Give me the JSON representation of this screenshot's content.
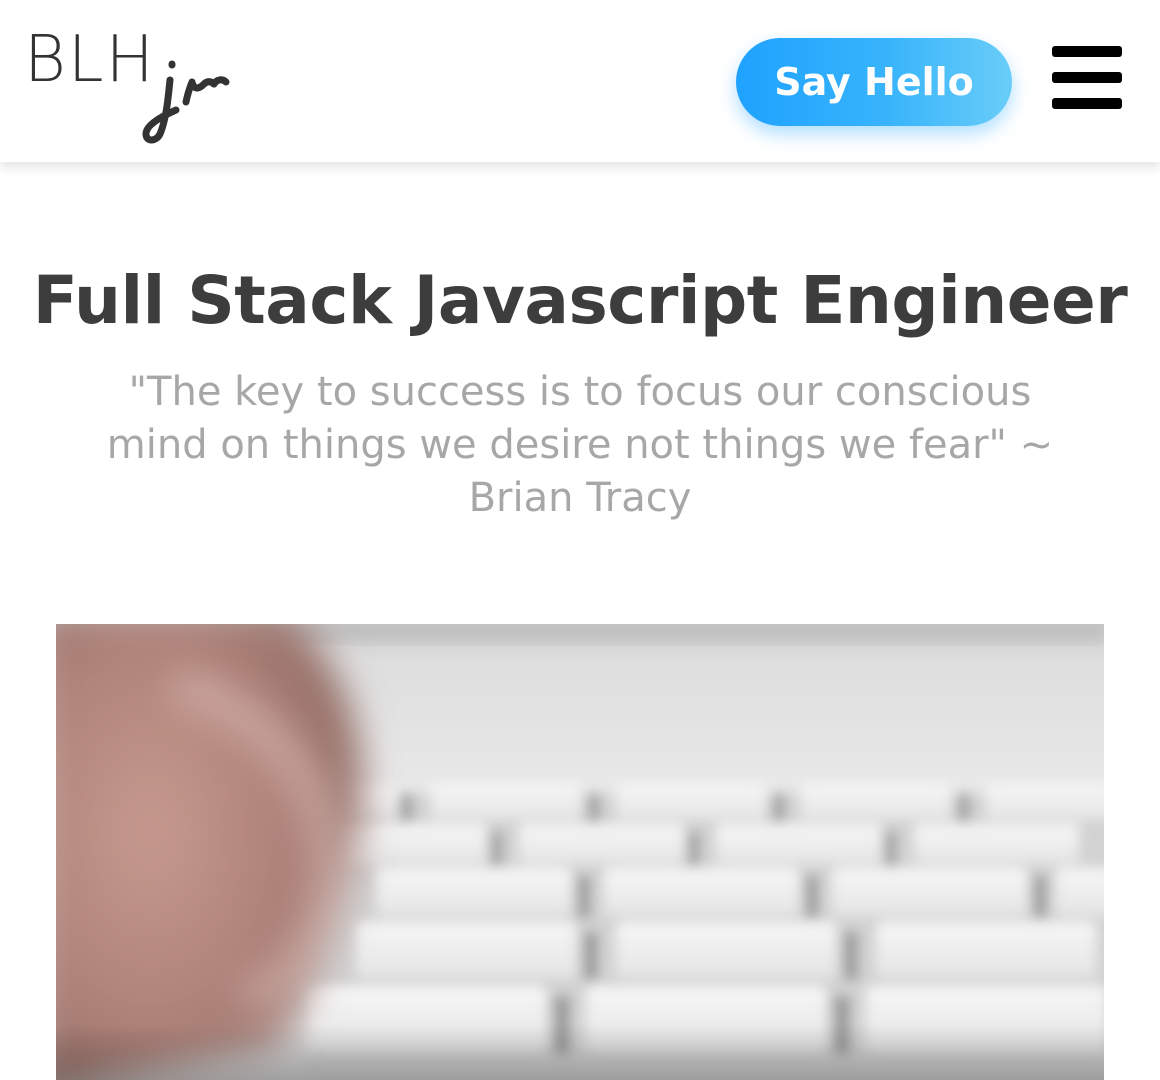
{
  "header": {
    "logo": {
      "main_text": "BLH",
      "sub_text": "jr"
    },
    "cta_label": "Say Hello",
    "menu_icon": "hamburger-menu-icon"
  },
  "hero": {
    "title": "Full Stack Javascript Engineer",
    "quote": "\"The key to success is to focus our conscious mind on things we desire not things we fear\" ~ Brian Tracy"
  },
  "media": {
    "image_subject": "blurred hand typing on white keyboard"
  },
  "colors": {
    "accent_start": "#1fa2ff",
    "accent_end": "#69cdf8",
    "title": "#3d3d3d",
    "quote": "#a7a7a7"
  }
}
